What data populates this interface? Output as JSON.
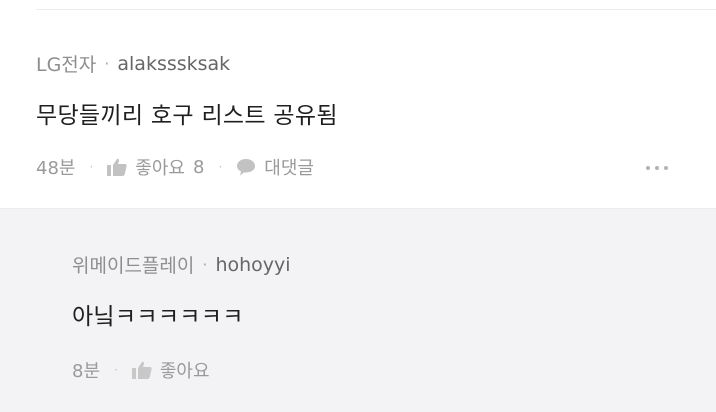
{
  "comment": {
    "org": "LG전자",
    "separator": "·",
    "username": "alaksssksak",
    "text": "무당들끼리 호구 리스트 공유됨",
    "time": "48분",
    "like_label": "좋아요",
    "like_count": "8",
    "reply_label": "대댓글"
  },
  "reply": {
    "org": "위메이드플레이",
    "separator": "·",
    "username": "hohoyyi",
    "text": "아닠ㅋㅋㅋㅋㅋㅋ",
    "time": "8분",
    "like_label": "좋아요"
  },
  "icons": {
    "like": "thumbs-up-icon",
    "reply": "speech-bubble-icon",
    "more": "more-dots-icon"
  },
  "colors": {
    "reply_background": "#f3f3f5",
    "meta_text": "#8e8e8e",
    "icon": "#c2c2c2"
  }
}
